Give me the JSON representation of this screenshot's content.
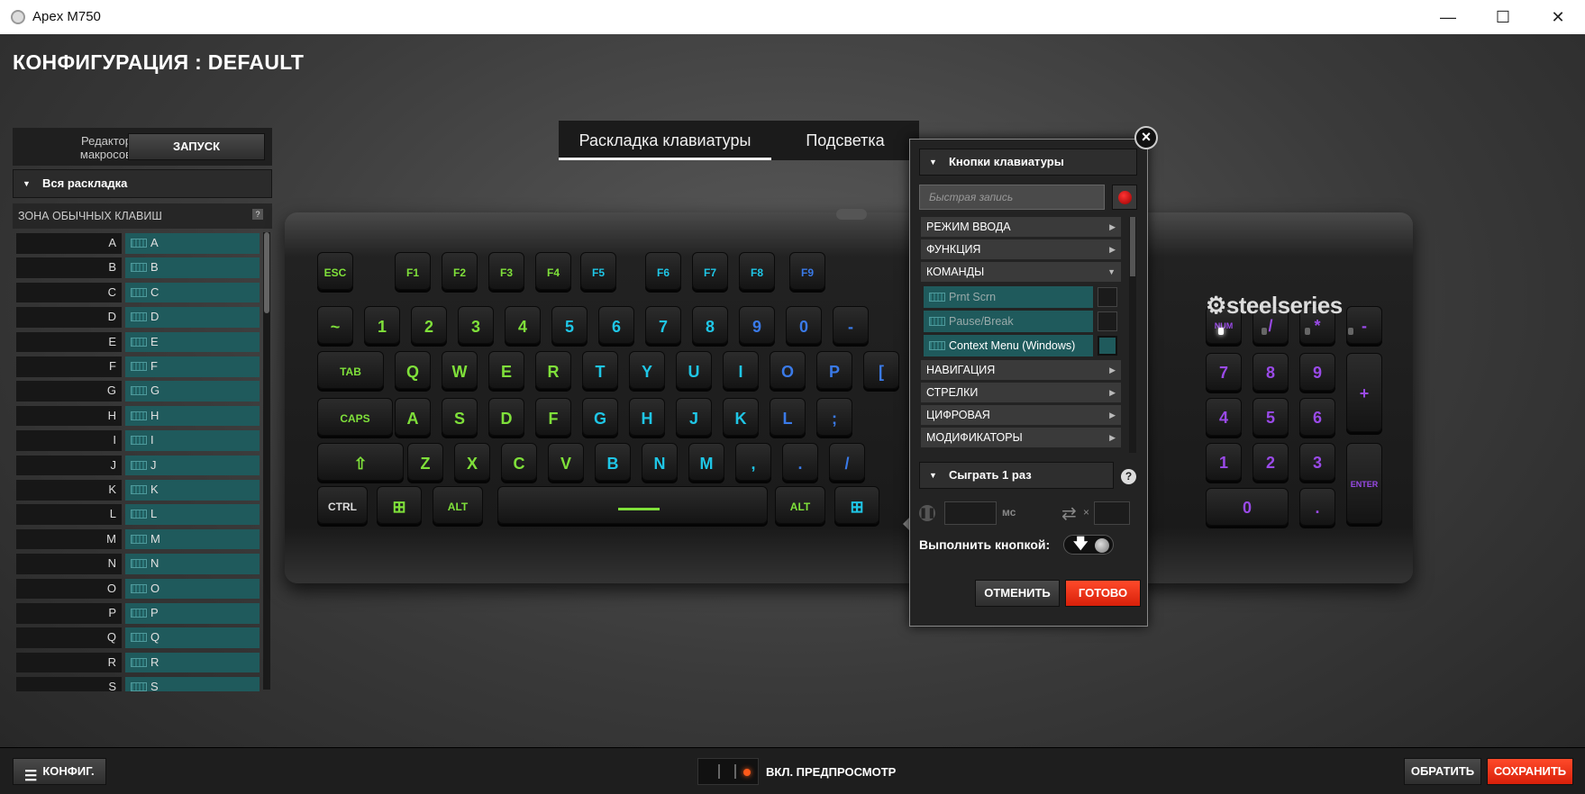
{
  "window": {
    "title": "Apex M750",
    "min_icon": "minimize-icon",
    "max_icon": "maximize-icon",
    "close_icon": "close-icon"
  },
  "config_title": "КОНФИГУРАЦИЯ : DEFAULT",
  "left_panel": {
    "macro_editor_label": "Редактор\nмакросов",
    "run_button": "ЗАПУСК",
    "layout_select": "Вся раскладка",
    "zone_label": "ЗОНА ОБЫЧНЫХ КЛАВИШ",
    "zone_help": "?",
    "keys": [
      {
        "name": "A",
        "map": "A"
      },
      {
        "name": "B",
        "map": "B"
      },
      {
        "name": "C",
        "map": "C"
      },
      {
        "name": "D",
        "map": "D"
      },
      {
        "name": "E",
        "map": "E"
      },
      {
        "name": "F",
        "map": "F"
      },
      {
        "name": "G",
        "map": "G"
      },
      {
        "name": "H",
        "map": "H"
      },
      {
        "name": "I",
        "map": "I"
      },
      {
        "name": "J",
        "map": "J"
      },
      {
        "name": "K",
        "map": "K"
      },
      {
        "name": "L",
        "map": "L"
      },
      {
        "name": "M",
        "map": "M"
      },
      {
        "name": "N",
        "map": "N"
      },
      {
        "name": "O",
        "map": "O"
      },
      {
        "name": "P",
        "map": "P"
      },
      {
        "name": "Q",
        "map": "Q"
      },
      {
        "name": "R",
        "map": "R"
      },
      {
        "name": "S",
        "map": "S"
      }
    ]
  },
  "tabs": [
    {
      "label": "Раскладка клавиатуры",
      "active": true
    },
    {
      "label": "Подсветка",
      "active": false
    }
  ],
  "keyboard": {
    "logo": "steelseries",
    "rows": [
      [
        "ESC",
        "F1",
        "F2",
        "F3",
        "F4",
        "F5",
        "F6",
        "F7",
        "F8",
        "F9"
      ],
      [
        "~",
        "1",
        "2",
        "3",
        "4",
        "5",
        "6",
        "7",
        "8",
        "9",
        "0",
        "-"
      ],
      [
        "TAB",
        "Q",
        "W",
        "E",
        "R",
        "T",
        "Y",
        "U",
        "I",
        "O",
        "P",
        "["
      ],
      [
        "CAPS",
        "A",
        "S",
        "D",
        "F",
        "G",
        "H",
        "J",
        "K",
        "L",
        ";"
      ],
      [
        "⇧",
        "Z",
        "X",
        "C",
        "V",
        "B",
        "N",
        "M",
        ",",
        ".",
        "/"
      ],
      [
        "CTRL",
        "⊞",
        "ALT",
        "",
        "ALT",
        "⊞"
      ]
    ],
    "numpad": [
      [
        "NUM LOCK",
        "/",
        "*",
        "-"
      ],
      [
        "7",
        "8",
        "9",
        "+"
      ],
      [
        "4",
        "5",
        "6"
      ],
      [
        "1",
        "2",
        "3",
        "ENTER"
      ],
      [
        "0",
        "."
      ]
    ]
  },
  "popup": {
    "close": "×",
    "header": "Кнопки клавиатуры",
    "quick_record_placeholder": "Быстрая запись",
    "categories": [
      {
        "label": "РЕЖИМ ВВОДА",
        "arrow": "▶"
      },
      {
        "label": "ФУНКЦИЯ",
        "arrow": "▶"
      },
      {
        "label": "КОМАНДЫ",
        "arrow": "▼"
      }
    ],
    "commands": [
      {
        "label": "Prnt Scrn",
        "selected": false
      },
      {
        "label": "Pause/Break",
        "selected": false
      },
      {
        "label": "Context Menu (Windows)",
        "selected": true
      }
    ],
    "categories2": [
      {
        "label": "НАВИГАЦИЯ",
        "arrow": "▶"
      },
      {
        "label": "СТРЕЛКИ",
        "arrow": "▶"
      },
      {
        "label": "ЦИФРОВАЯ",
        "arrow": "▶"
      },
      {
        "label": "МОДИФИКАТОРЫ",
        "arrow": "▶"
      }
    ],
    "play_mode": "Сыграть 1 раз",
    "help": "?",
    "ms_label": "мс",
    "repeat_x": "×",
    "execute_label": "Выполнить кнопкой:",
    "cancel": "ОТМЕНИТЬ",
    "done": "ГОТОВО"
  },
  "bottom": {
    "config_button": "КОНФИГ.",
    "preview_label": "ВКЛ. ПРЕДПРОСМОТР",
    "undo": "ОБРАТИТЬ",
    "save": "СОХРАНИТЬ"
  },
  "colors": {
    "accent": "#e8340f",
    "key_map_bg": "#1f5a5c",
    "green": "#7fe03a",
    "cyan": "#1fc6e6",
    "blue": "#3a7ae8",
    "purple": "#9a4ae8"
  }
}
